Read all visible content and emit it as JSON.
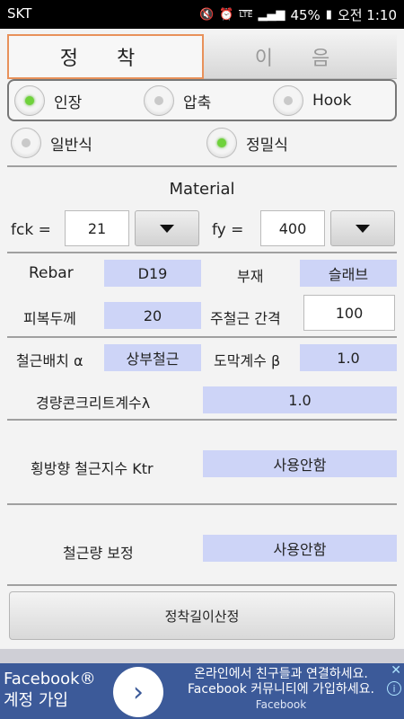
{
  "status": {
    "carrier": "SKT",
    "battery": "45%",
    "time": "오전 1:10",
    "network": "LTE"
  },
  "tabs": [
    {
      "label": "정 착"
    },
    {
      "label": "이 음"
    }
  ],
  "load_type": {
    "options": [
      "인장",
      "압축",
      "Hook"
    ],
    "selected": "인장"
  },
  "method": {
    "options": [
      "일반식",
      "정밀식"
    ],
    "selected": "정밀식"
  },
  "material": {
    "title": "Material",
    "fck_label": "fck =",
    "fck_value": "21",
    "fy_label": "fy =",
    "fy_value": "400"
  },
  "rebar": {
    "label": "Rebar",
    "value": "D19"
  },
  "member": {
    "label": "부재",
    "value": "슬래브"
  },
  "cover": {
    "label": "피복두께",
    "value": "20"
  },
  "spacing": {
    "label": "주철근 간격",
    "value": "100"
  },
  "placement": {
    "label": "철근배치 α",
    "value": "상부철근"
  },
  "coating": {
    "label": "도막계수 β",
    "value": "1.0"
  },
  "lightweight": {
    "label": "경량콘크리트계수λ",
    "value": "1.0"
  },
  "ktr": {
    "label": "횡방향 철근지수 Ktr",
    "value": "사용안함"
  },
  "correction": {
    "label": "철근량 보정",
    "value": "사용안함"
  },
  "calc_button": "정착길이산정",
  "ad": {
    "brand_line1": "Facebook®",
    "brand_line2": "계정 가입",
    "line1": "온라인에서 친구들과 연결하세요.",
    "line2": "Facebook 커뮤니티에 가입하세요.",
    "source": "Facebook",
    "accent": "#3c5a99"
  }
}
